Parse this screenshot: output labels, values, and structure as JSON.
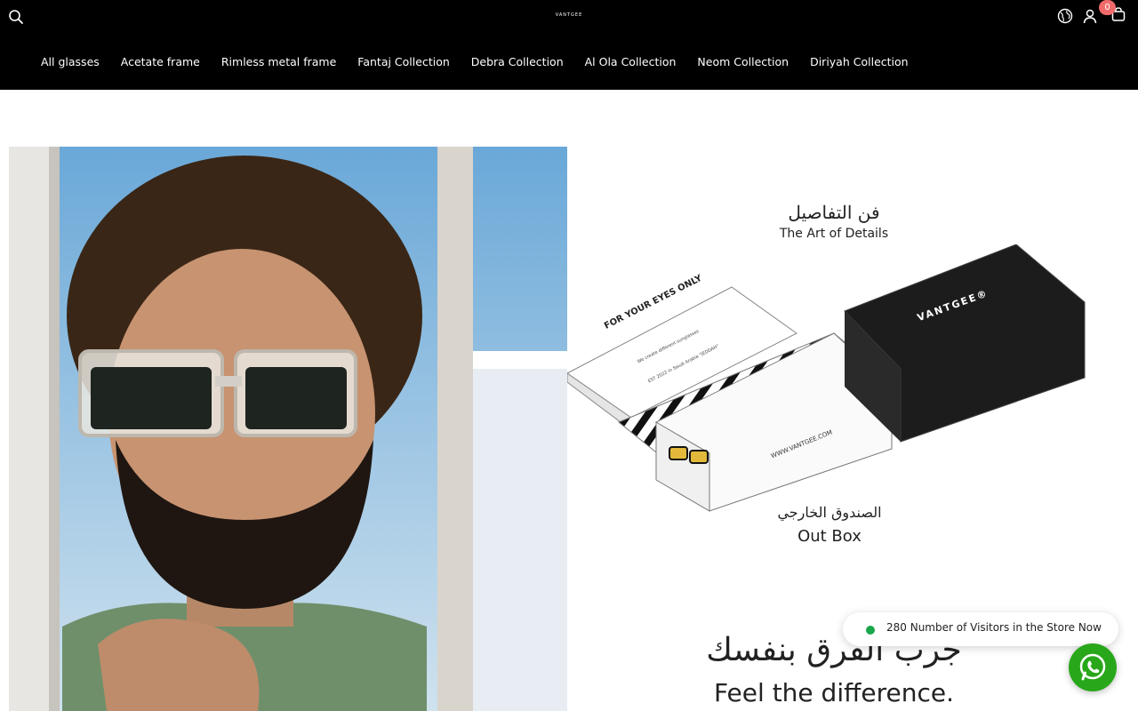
{
  "header": {
    "logo_text": "VANTGEE",
    "cart_count": "0",
    "icons": [
      "search-icon",
      "globe-icon",
      "user-icon",
      "cart-icon"
    ]
  },
  "nav": {
    "items": [
      {
        "label": "All glasses"
      },
      {
        "label": "Acetate frame"
      },
      {
        "label": "Rimless metal frame"
      },
      {
        "label": "Fantaj Collection"
      },
      {
        "label": "Debra Collection"
      },
      {
        "label": "Al Ola Collection"
      },
      {
        "label": "Neom Collection"
      },
      {
        "label": "Diriyah Collection"
      }
    ]
  },
  "hero": {
    "ar_title": "فن التفاصيل",
    "en_title": "The Art of Details",
    "box_lid_text": "FOR YOUR EYES ONLY",
    "box_lid_small": "We create different sunglasses",
    "box_lid_est": "EST 2022 in Saudi Arabia \"JEDDAH\"",
    "box_brand": "VANTGEE®",
    "box_url": "WWW.VANTGEE.COM",
    "ar_outbox": "الصندوق الخارجي",
    "en_outbox": "Out Box",
    "ar_tagline": "جرب الفرق بنفسك",
    "en_tagline": "Feel the difference."
  },
  "widgets": {
    "visitors_text": "280 Number of Visitors in the Store Now",
    "whatsapp_icon": "whatsapp-icon",
    "colors": {
      "header_bg": "#000000",
      "badge": "#f06a6a",
      "whatsapp": "#29a71a",
      "online_dot": "#1aa64a"
    }
  }
}
